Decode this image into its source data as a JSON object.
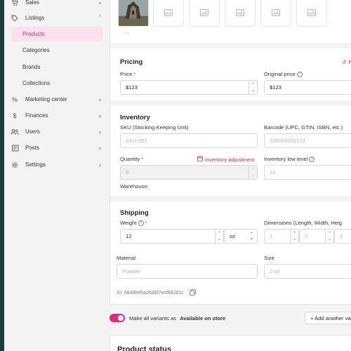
{
  "sidebar": {
    "sales": "Sales",
    "listings": "Listings",
    "products": "Products",
    "categories": "Categories",
    "brands": "Brands",
    "collections": "Collections",
    "marketing": "Marketing center",
    "finances": "Finances",
    "users": "Users",
    "posts": "Posts",
    "settings": "Settings"
  },
  "media": {
    "more": "..."
  },
  "pricing": {
    "title": "Pricing",
    "price_label": "Price",
    "price_value": "$123",
    "original_label": "Original price",
    "original_value": "$123",
    "edge_link": "P"
  },
  "inventory": {
    "title": "Inventory",
    "sku_label": "SKU (Stocking Keeping Unit)",
    "sku_placeholder": "SKU-001",
    "barcode_label": "Barcode (UPC, GTIN, ISBN, etc.)",
    "barcode_placeholder": "100000000123",
    "quantity_label": "Quantity",
    "adjust_link": "Inventory adjustment",
    "quantity_value": "0",
    "low_label": "Inventory low level",
    "low_placeholder": "10",
    "warehouse_label": "Warehouse:"
  },
  "shipping": {
    "title": "Shipping",
    "weight_label": "Weight",
    "weight_value": "12",
    "unit": "oz",
    "dimensions_label": "Dimensions (Length, Width, Heig",
    "dim_1": "1",
    "dim_2": "2",
    "dim_3": "3"
  },
  "attributes": {
    "material_label": "Material",
    "material_placeholder": "Powder",
    "size_label": "Size",
    "size_placeholder": "2 oz",
    "id_text": "ID: 6848fef6a26d6f7ecf99261c"
  },
  "variants": {
    "toggle_text": "Make all variants as",
    "toggle_bold": "Available on store",
    "add_button": "+ Add another va"
  },
  "status": {
    "title": "Product status"
  },
  "colors": {
    "accent": "#e6287d",
    "active_bg": "#fbe0ee"
  }
}
